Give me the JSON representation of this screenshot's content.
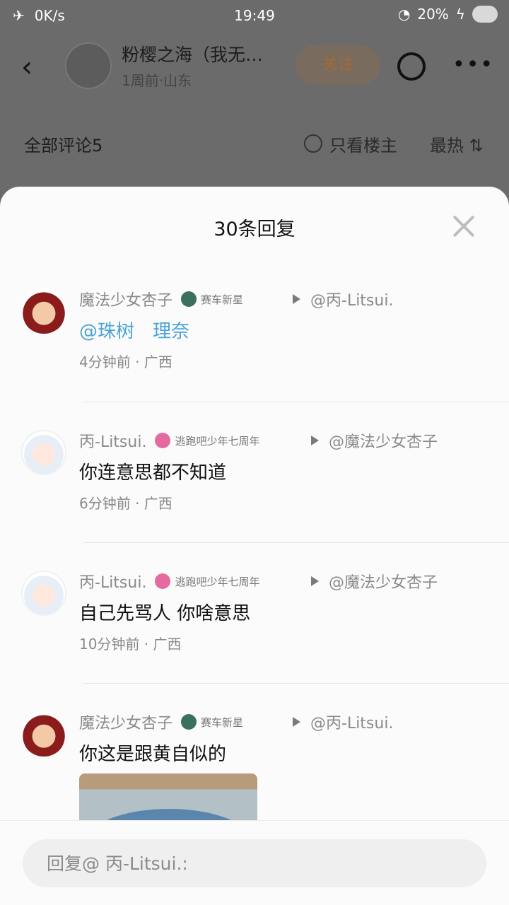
{
  "status_bar": {
    "speed": "0K/s",
    "time": "19:49",
    "battery": "20%"
  },
  "post_header": {
    "title": "粉樱之海（我无…",
    "meta": "1周前·山东",
    "follow_label": "关注"
  },
  "comments_bar": {
    "title": "全部评论5",
    "only_owner_label": "只看楼主",
    "sort_label": "最热 ⇅"
  },
  "sheet": {
    "title": "30条回复"
  },
  "replies": [
    {
      "username": "魔法少女杏子",
      "badge": "赛车新星",
      "target": "@丙-Litsui.",
      "content": "@珠树　理奈",
      "time": "4分钟前 · 广西"
    },
    {
      "username": "丙-Litsui.",
      "badge": "逃跑吧少年七周年",
      "target": "@魔法少女杏子",
      "content": "你连意思都不知道",
      "time": "6分钟前 · 广西"
    },
    {
      "username": "丙-Litsui.",
      "badge": "逃跑吧少年七周年",
      "target": "@魔法少女杏子",
      "content": "自己先骂人 你啥意思",
      "time": "10分钟前 · 广西"
    },
    {
      "username": "魔法少女杏子",
      "badge": "赛车新星",
      "target": "@丙-Litsui.",
      "content": "你这是跟黄自似的"
    }
  ],
  "reply_input": {
    "placeholder": "回复@ 丙-Litsui.:"
  },
  "colors": {
    "mention": "#4aa3d8",
    "sheet_bg": "#fbfbfb",
    "dim_bg": "#6b6b6b"
  }
}
